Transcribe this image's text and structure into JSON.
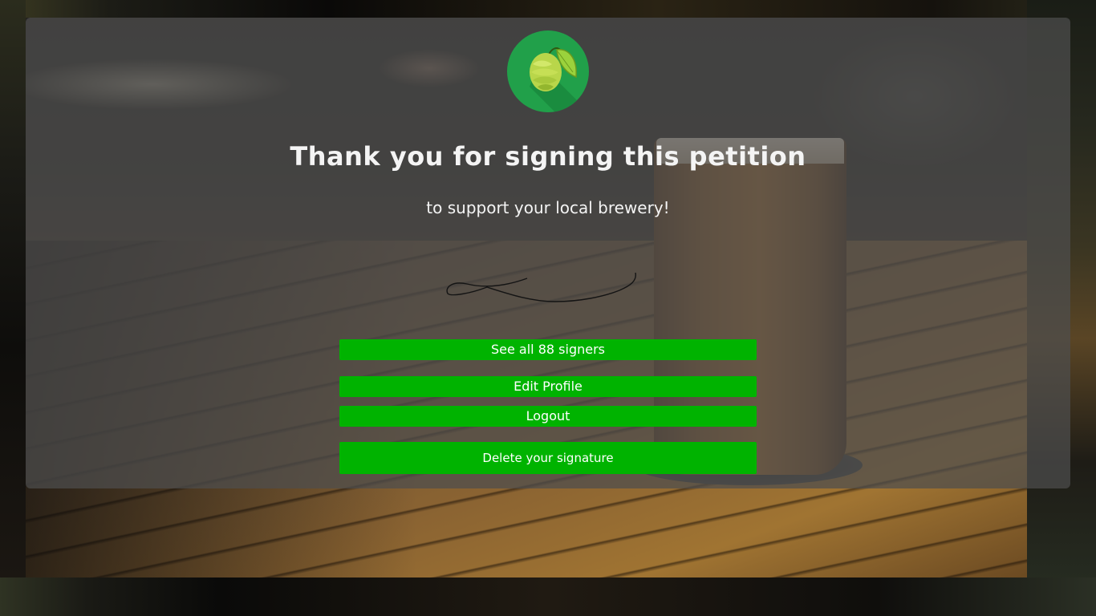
{
  "heading": {
    "title": "Thank you for signing this petition",
    "subtitle": "to support your local brewery!"
  },
  "actions": {
    "see_signers_label": "See all 88 signers",
    "edit_profile_label": "Edit Profile",
    "logout_label": "Logout",
    "delete_signature_label": "Delete your signature"
  },
  "signature": {
    "icon": "handwritten-signature"
  },
  "logo": {
    "icon": "hop-cone-icon",
    "background_color": "#21a04a"
  },
  "colors": {
    "button": "#00b300",
    "card_overlay": "rgba(78,78,78,0.72)",
    "text": "#f4f4f4"
  }
}
